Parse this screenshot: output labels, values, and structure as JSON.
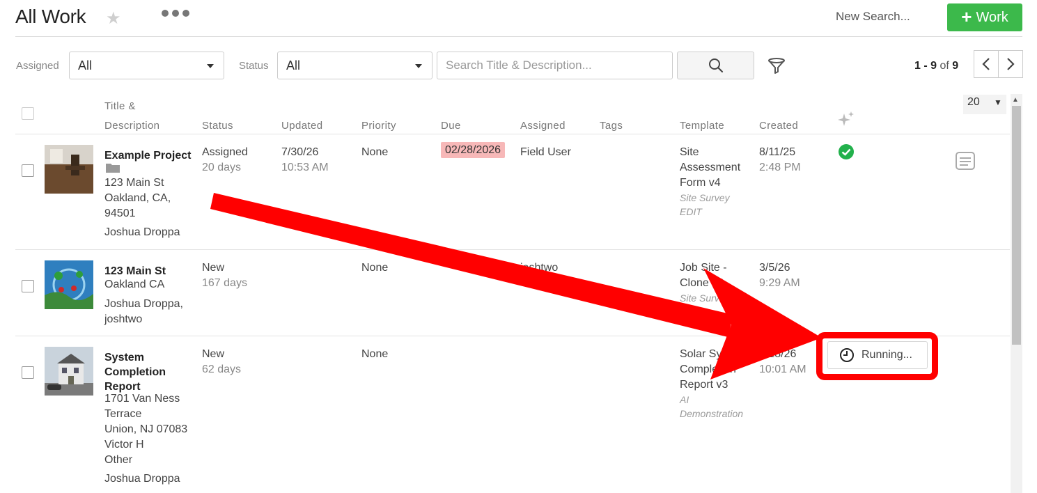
{
  "header": {
    "title": "All Work",
    "new_search": "New Search...",
    "add_work_label": "Work"
  },
  "filters": {
    "assigned_label": "Assigned",
    "assigned_value": "All",
    "status_label": "Status",
    "status_value": "All",
    "search_placeholder": "Search Title & Description..."
  },
  "pager": {
    "range": "1 - 9",
    "of": "of",
    "total": "9",
    "per_page": "20"
  },
  "columns": {
    "title_line1": "Title &",
    "title_line2": "Description",
    "status": "Status",
    "updated": "Updated",
    "priority": "Priority",
    "due": "Due",
    "assigned": "Assigned",
    "tags": "Tags",
    "template": "Template",
    "created": "Created"
  },
  "rows": [
    {
      "title": "Example Project",
      "address": [
        "123 Main St",
        "Oakland, CA,",
        "94501"
      ],
      "people": [
        "Joshua Droppa"
      ],
      "status": "Assigned",
      "status_age": "20 days",
      "updated_date": "7/30/26",
      "updated_time": "10:53 AM",
      "priority": "None",
      "due": "02/28/2026",
      "assigned": "Field User",
      "template": [
        "Site",
        "Assessment",
        "Form v4"
      ],
      "template_sub": [
        "Site Survey",
        "EDIT"
      ],
      "created_date": "8/11/25",
      "created_time": "2:48 PM"
    },
    {
      "title": "123 Main St",
      "address": [
        "Oakland CA"
      ],
      "people": [
        "Joshua Droppa,",
        "joshtwo"
      ],
      "status": "New",
      "status_age": "167 days",
      "priority": "None",
      "assigned": "joshtwo",
      "template": [
        "Job Site -",
        "Clone v2"
      ],
      "template_sub": [
        "Site Survey",
        "EDIT"
      ],
      "created_date": "3/5/26",
      "created_time": "9:29 AM"
    },
    {
      "title": [
        "System",
        "Completion",
        "Report"
      ],
      "address": [
        "1701 Van Ness",
        "Terrace",
        "Union, NJ 07083",
        "Victor H",
        "Other"
      ],
      "people": [
        "Joshua Droppa"
      ],
      "status": "New",
      "status_age": "62 days",
      "priority": "None",
      "template": [
        "Solar System",
        "Completion",
        "Report v3"
      ],
      "template_sub": [
        "AI",
        "Demonstration"
      ],
      "created_date": "6/18/26",
      "created_time": "10:01 AM",
      "ai_status": "Running..."
    }
  ],
  "colors": {
    "accent_green": "#3cb94b",
    "success_green": "#22b14c",
    "due_badge_bg": "#f7b8b8",
    "annotation_red": "#ff0000"
  },
  "icons": [
    "star-icon",
    "more-icon",
    "plus-icon",
    "caret-down-icon",
    "search-icon",
    "filter-icon",
    "chevron-left-icon",
    "chevron-right-icon",
    "sparkle-icon",
    "check-circle-icon",
    "folder-icon",
    "notes-icon",
    "clock-icon"
  ]
}
